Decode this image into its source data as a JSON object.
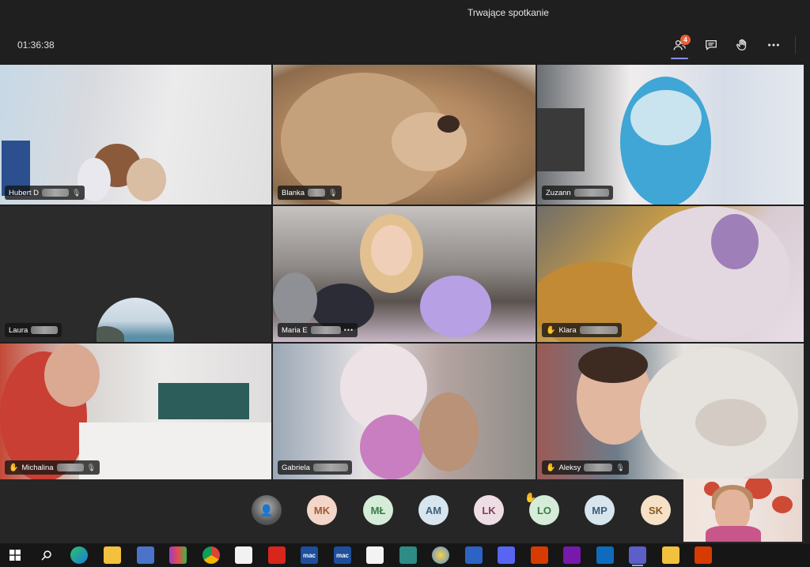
{
  "window": {
    "title": "Trwające spotkanie"
  },
  "meeting": {
    "timer": "01:36:38",
    "participants_badge": "4"
  },
  "tiles": [
    {
      "name": "Hubert D"
    },
    {
      "name": "Blanka"
    },
    {
      "name": "Zuzann"
    },
    {
      "name": "Laura"
    },
    {
      "name": "Maria E"
    },
    {
      "name": "Klara"
    },
    {
      "name": "Michalina"
    },
    {
      "name": "Gabriela"
    },
    {
      "name": "Aleksy"
    }
  ],
  "roster": {
    "avatars": [
      "MK",
      "MŁ",
      "AM",
      "LK",
      "LO",
      "MP",
      "SK"
    ]
  },
  "taskbar": {
    "apps": [
      "mac",
      "mac"
    ]
  },
  "icons": {
    "participants": "people-icon",
    "chat": "chat-icon",
    "raise_hand": "hand-icon",
    "more": "more-icon",
    "mic_off": "mic-off-icon"
  },
  "colors": {
    "accent": "#8b8cf0",
    "badge": "#e8603c",
    "hand": "#f0c53c"
  }
}
